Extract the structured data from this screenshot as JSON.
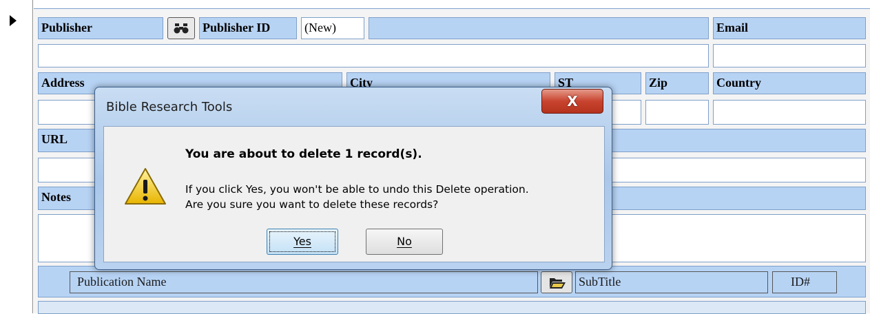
{
  "form": {
    "publisher_label": "Publisher",
    "find_icon": "binoculars-icon",
    "publisher_id_label": "Publisher ID",
    "publisher_id_value": "(New)",
    "email_label": "Email",
    "address_label": "Address",
    "city_label": "City",
    "st_label": "ST",
    "zip_label": "Zip",
    "country_label": "Country",
    "url_label": "URL",
    "notes_label": "Notes"
  },
  "subform": {
    "publication_name_label": "Publication Name",
    "folder_icon": "folder-open-icon",
    "subtitle_label": "SubTitle",
    "id_label": "ID#"
  },
  "dialog": {
    "title": "Bible Research Tools",
    "close_label": "X",
    "icon": "warning-icon",
    "message_main": "You are about to delete 1 record(s).",
    "message_line1": "If you click Yes, you won't be able to undo this Delete operation.",
    "message_line2": "Are you sure you want to delete these records?",
    "yes_label": "Yes",
    "no_label": "No"
  },
  "colors": {
    "label_bg": "#b7d3f4",
    "close_red": "#c8442f"
  }
}
